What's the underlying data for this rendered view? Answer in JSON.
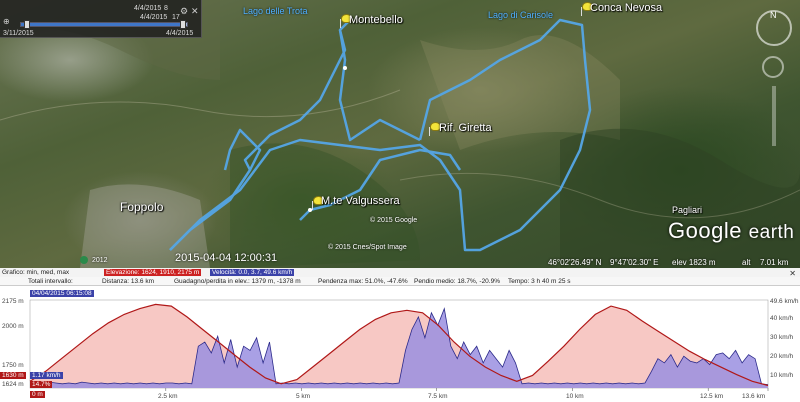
{
  "time_slider": {
    "top_date": "4/4/2015",
    "top_value": "8",
    "top_date2": "4/4/2015",
    "top_value2": "17",
    "left_date": "3/11/2015",
    "right_date": "4/4/2015",
    "progress": 0.97
  },
  "map": {
    "places": {
      "montebello": "Montebello",
      "conca_nevosa": "Conca Nevosa",
      "rif_giretta": "Rif. Giretta",
      "valgussera": "M.te Valgussera",
      "foppolo": "Foppolo",
      "pagliari": "Pagliari"
    },
    "lakes": {
      "trota": "Lago delle Trota",
      "carisole": "Lago di Carisole"
    },
    "copyright_1": "© 2015 Google",
    "copyright_2": "© 2015 Cnes/Spot Image",
    "year_badge": "2012",
    "timestamp": "2015-04-04 12:00:31",
    "brand": "Google earth",
    "status": {
      "lat": "46°02'26.49\" N",
      "lon": "9°47'02.30\" E",
      "elev": "elev 1823 m",
      "alt": "alt",
      "alt_value": "7.01 km"
    }
  },
  "profile": {
    "header1": {
      "graph_label": "Grafico: min, med, max",
      "elevation": "Elevazione: 1624, 1910, 2175 m",
      "speed": "Velocità: 0.0, 3.7, 49.6 km/h"
    },
    "header2": {
      "totals": "Totali intervallo:",
      "distance": "Distanza: 13.6 km",
      "gain": "Guadagno/perdita in elev.: 1379 m, -1378 m",
      "slope_max": "Pendenza max: 51.0%, -47.6%",
      "slope_avg": "Pendio medio: 18.7%, -20.9%",
      "time": "Tempo: 3 h 40 m 25 s"
    },
    "date_badge": "04/04/2015 06:15:08",
    "y_labels_left": [
      "2175 m",
      "2000 m",
      "1750 m",
      "1630 m",
      "1624 m"
    ],
    "y_labels_right": [
      "49.6 km/h",
      "40 km/h",
      "30 km/h",
      "20 km/h",
      "10 km/h"
    ],
    "x_labels": [
      "2.5 km",
      "5 km",
      "7.5 km",
      "10 km",
      "12.5 km",
      "13.6 km"
    ],
    "cursor_values": [
      "1.17 km/h",
      "14.7%",
      "0 m"
    ],
    "colors": {
      "elevation_fill": "#f7c8c4",
      "elevation_line": "#b01818",
      "speed_fill": "#9a8fe0",
      "speed_line": "#2b2a8a",
      "track": "#55a6e6"
    }
  }
}
